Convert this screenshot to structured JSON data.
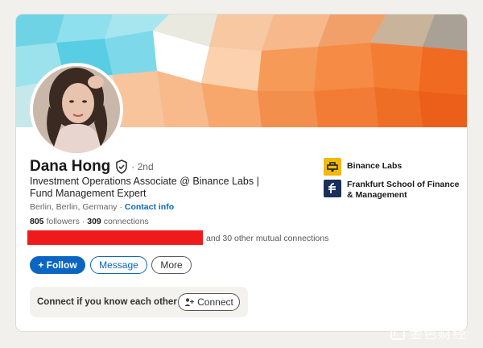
{
  "profile": {
    "name": "Dana Hong",
    "degree": "· 2nd",
    "headline": "Investment Operations Associate @ Binance Labs | Fund Management Expert",
    "location": "Berlin, Berlin, Germany ·",
    "contact_label": "Contact info",
    "followers_count": "805",
    "followers_label": "followers",
    "connections_count": "309",
    "connections_label": "connections",
    "mutual_text": "and 30 other mutual connections"
  },
  "actions": {
    "follow_label": "+ Follow",
    "message_label": "Message",
    "more_label": "More"
  },
  "connect_prompt": {
    "text": "Connect if you know each other",
    "button_label": "Connect"
  },
  "organizations": [
    {
      "name": "Binance Labs",
      "logo_color": "#f0b90b"
    },
    {
      "name": "Frankfurt School of Finance & Management",
      "logo_color": "#1a2f5a"
    }
  ],
  "watermark": {
    "text": "金色财经"
  },
  "colors": {
    "accent": "#0a66c2",
    "redaction": "#ef1a1a"
  }
}
